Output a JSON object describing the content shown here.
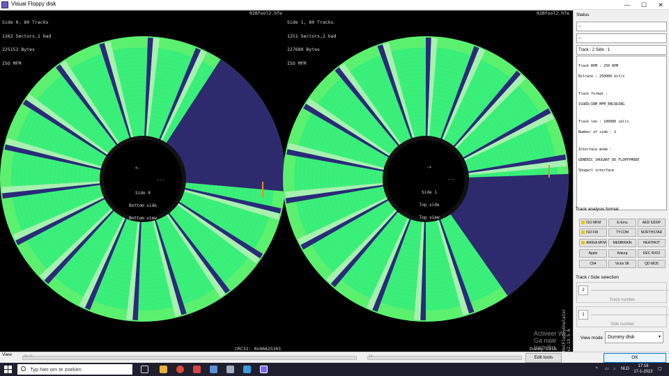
{
  "window": {
    "title": "Visual Floppy disk",
    "minimize_glyph": "—",
    "maximize_glyph": "☐",
    "close_glyph": "✕"
  },
  "disk_view": {
    "side0": {
      "info_lines": [
        "Side 0, 80 Tracks",
        "1262 Sectors,1 bad",
        "225152 Bytes",
        "ISO MFM"
      ],
      "filename": "02Bfool2.hfe",
      "center_arrow": "<-",
      "center_dash": "---",
      "center_lines": [
        "Side 0",
        "Bottom side",
        "Bottom view"
      ]
    },
    "side1": {
      "info_lines": [
        "Side 1, 80 Tracks",
        "1251 Sectors,2 bad",
        "227680 Bytes",
        "ISO MFM"
      ],
      "filename": "02Bfool2.hfe",
      "center_arrow": "->",
      "center_dash": "---",
      "center_lines": [
        "Side 1",
        "Top side",
        "Top view"
      ]
    },
    "crc_label": "CRC32: 0x90A25301",
    "dummy_label": "Dummy disk",
    "version_label": "HxCFloppyEmulator v2.13.5.6",
    "watermark": {
      "line1": "Activeer W",
      "line2": "Ga naar Instellin"
    },
    "colors": {
      "good": "#5cf06f",
      "sector": "#3af07a",
      "gap": "#2b2a7a",
      "light": "#a8f0b0",
      "bad_region": "#2d2b6e"
    }
  },
  "right_panel": {
    "status_label": "Status",
    "status_field1": "--",
    "status_field2": "--",
    "track_info": "Track : 2 Side : 1",
    "status_text": [
      "Track RPM : 250 RPM",
      "Bitrate : 250000 bit/s",
      "",
      "Track format :",
      "ISODD/IBM_MFM_ENCODING",
      "",
      "Track len : 100080 cells",
      "Number of side : 2",
      "",
      "Interface mode :",
      "GENERIC_SHUGART_DD_FLOPPYMODE",
      "Shugart interface"
    ],
    "format_label": "Track analysis format",
    "format_buttons": [
      {
        "label": "ISO MFM",
        "checked": true
      },
      {
        "label": "E-Emu",
        "checked": false
      },
      {
        "label": "AED 6200P",
        "checked": false
      },
      {
        "label": "ISO FM",
        "checked": true
      },
      {
        "label": "TYCOM",
        "checked": false
      },
      {
        "label": "NORTHSTAR",
        "checked": false
      },
      {
        "label": "AMIGA MFM",
        "checked": true
      },
      {
        "label": "MEMBRAIN",
        "checked": false
      },
      {
        "label": "HEATHKIT",
        "checked": false
      },
      {
        "label": "Apple",
        "checked": false
      },
      {
        "label": "Arburg",
        "checked": false
      },
      {
        "label": "DEC RX02",
        "checked": false
      },
      {
        "label": "C64",
        "checked": false
      },
      {
        "label": "Victor 9K",
        "checked": false
      },
      {
        "label": "QD MO5",
        "checked": false
      }
    ],
    "track_side_label": "Track / Side selection",
    "track_value": "2",
    "track_number_label": "Track number",
    "side_value": "1",
    "side_number_label": "Side number",
    "view_mode_label": "View mode",
    "view_mode_value": "Dummy disk",
    "ok_label": "OK"
  },
  "bottom": {
    "view_label": "View",
    "zoom_value1": "00.70",
    "zoom_value2": "18",
    "edit_tools_label": "Edit tools"
  },
  "taskbar": {
    "search_placeholder": "Typ hier om te zoeken",
    "time": "17:16",
    "date": "17-1-2022",
    "lang": "NLD"
  }
}
